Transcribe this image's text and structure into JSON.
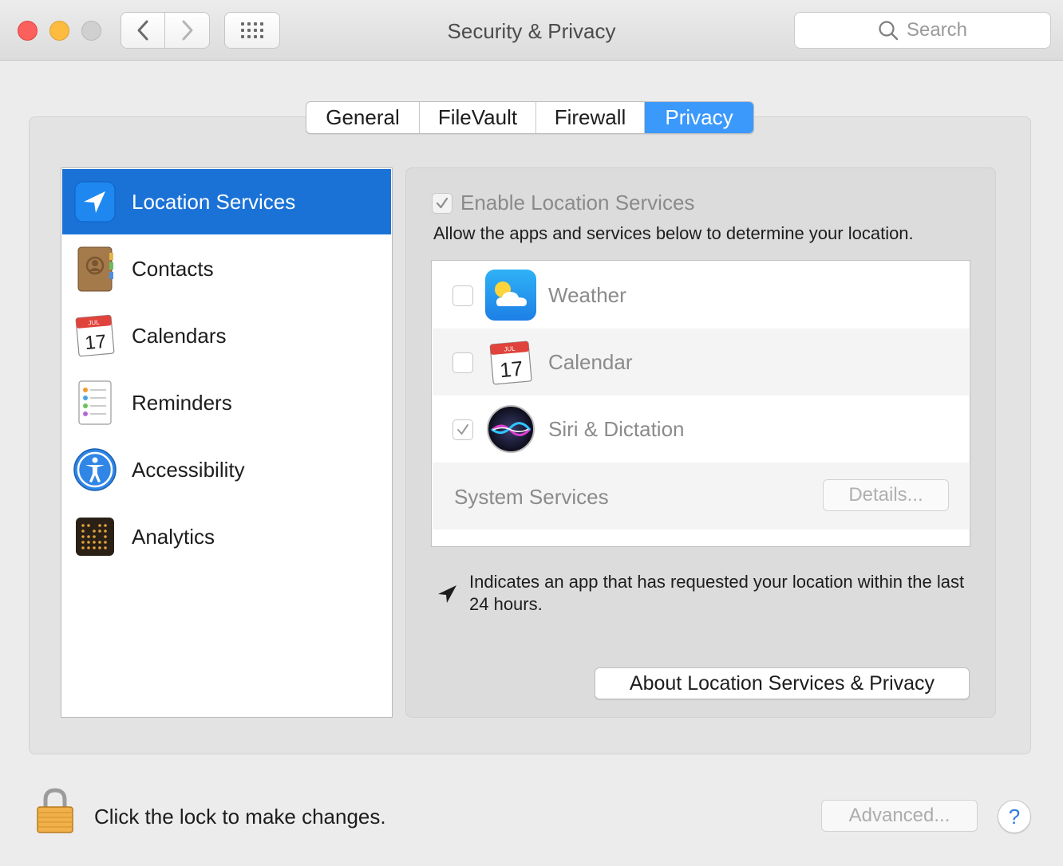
{
  "window": {
    "title": "Security & Privacy",
    "search_placeholder": "Search"
  },
  "tabs": [
    {
      "label": "General"
    },
    {
      "label": "FileVault"
    },
    {
      "label": "Firewall"
    },
    {
      "label": "Privacy",
      "active": true
    }
  ],
  "sidebar": {
    "items": [
      {
        "label": "Location Services",
        "icon": "location-arrow-icon",
        "selected": true
      },
      {
        "label": "Contacts",
        "icon": "contacts-book-icon"
      },
      {
        "label": "Calendars",
        "icon": "calendar-icon"
      },
      {
        "label": "Reminders",
        "icon": "reminders-list-icon"
      },
      {
        "label": "Accessibility",
        "icon": "accessibility-icon"
      },
      {
        "label": "Analytics",
        "icon": "analytics-icon"
      }
    ]
  },
  "location": {
    "enable_label": "Enable Location Services",
    "enable_checked": true,
    "allow_text": "Allow the apps and services below to determine your location.",
    "apps": [
      {
        "name": "Weather",
        "checked": false,
        "icon": "weather-icon"
      },
      {
        "name": "Calendar",
        "checked": false,
        "icon": "calendar-icon"
      },
      {
        "name": "Siri & Dictation",
        "checked": true,
        "icon": "siri-icon"
      }
    ],
    "system_services_label": "System Services",
    "details_label": "Details...",
    "indicates_text": "Indicates an app that has requested your location within the last 24 hours.",
    "about_label": "About Location Services & Privacy"
  },
  "calendar_icon": {
    "month": "JUL",
    "day": "17"
  },
  "footer": {
    "lock_text": "Click the lock to make changes.",
    "advanced_label": "Advanced...",
    "help_label": "?"
  },
  "colors": {
    "accent": "#3b99fc",
    "selection": "#1a72d7",
    "close": "#fc605c",
    "minimize": "#fdbc40"
  }
}
